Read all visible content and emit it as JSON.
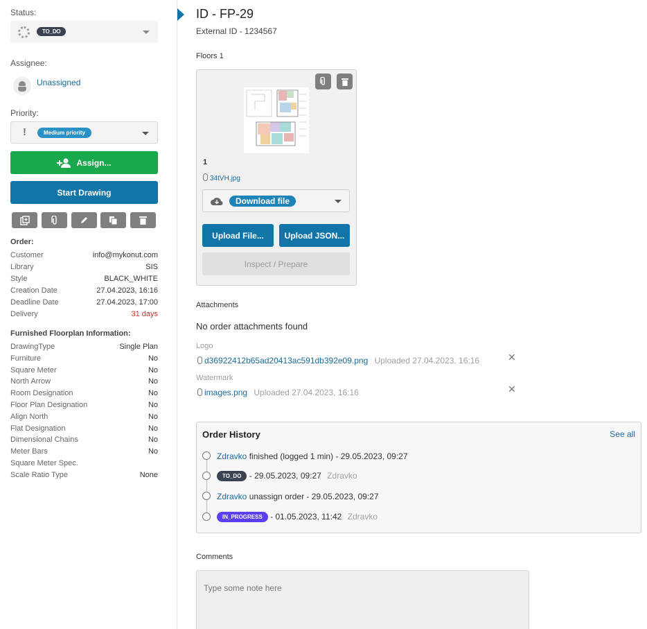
{
  "sidebar": {
    "status_label": "Status:",
    "status_value": "TO_DO",
    "assignee_label": "Assignee:",
    "assignee_value": "Unassigned",
    "priority_label": "Priority:",
    "priority_value": "Medium priority",
    "assign_button": "Assign...",
    "start_drawing_button": "Start Drawing",
    "order_title": "Order:",
    "order": [
      {
        "key": "Customer",
        "value": "info@mykonut.com"
      },
      {
        "key": "Library",
        "value": "SIS"
      },
      {
        "key": "Style",
        "value": "BLACK_WHITE"
      },
      {
        "key": "Creation Date",
        "value": "27.04.2023, 16:16"
      },
      {
        "key": "Deadline Date",
        "value": "27.04.2023, 17:00"
      },
      {
        "key": "Delivery",
        "value": "31 days"
      }
    ],
    "furnished_title": "Furnished Floorplan Information:",
    "furnished": [
      {
        "key": "DrawingType",
        "value": "Single Plan"
      },
      {
        "key": "Furniture",
        "value": "No"
      },
      {
        "key": "Square Meter",
        "value": "No"
      },
      {
        "key": "North Arrow",
        "value": "No"
      },
      {
        "key": "Room Designation",
        "value": "No"
      },
      {
        "key": "Floor Plan Designation",
        "value": "No"
      },
      {
        "key": "Align North",
        "value": "No"
      },
      {
        "key": "Flat Designation",
        "value": "No"
      },
      {
        "key": "Dimensional Chains",
        "value": "No"
      },
      {
        "key": "Meter Bars",
        "value": "No"
      },
      {
        "key": "Square Meter Spec.",
        "value": ""
      },
      {
        "key": "Scale Ratio Type",
        "value": "None"
      }
    ]
  },
  "main": {
    "title": "ID - FP-29",
    "external_id": "External ID - 1234567",
    "floors_label": "Floors 1",
    "floor": {
      "number": "1",
      "file_name": "34tVH.jpg",
      "download_label": "Download file",
      "upload_file": "Upload File...",
      "upload_json": "Upload JSON...",
      "inspect": "Inspect / Prepare"
    },
    "attachments_label": "Attachments",
    "no_attachments": "No order attachments found",
    "logo_label": "Logo",
    "logo_file": "d36922412b65ad20413ac591db392e09.png",
    "logo_uploaded": "Uploaded 27.04.2023, 16:16",
    "watermark_label": "Watermark",
    "watermark_file": "images.png",
    "watermark_uploaded": "Uploaded 27.04.2023, 16:16",
    "history": {
      "title": "Order History",
      "see_all": "See all",
      "entries": [
        {
          "user": "Zdravko",
          "text": " finished (logged 1 min) - 29.05.2023, 09:27"
        },
        {
          "badge": "TO_DO",
          "text": " - 29.05.2023, 09:27",
          "user": "Zdravko"
        },
        {
          "user": "Zdravko",
          "text": " unassign order - 29.05.2023, 09:27"
        },
        {
          "badge": "IN_PROGRESS",
          "text": " - 01.05.2023, 11:42",
          "user": "Zdravko"
        }
      ]
    },
    "comments_label": "Comments",
    "comment_placeholder": "Type some note here"
  },
  "colors": {
    "accent_blue": "#1275a8",
    "green": "#19a84b",
    "delivery_red": "#d2302a",
    "badge_dark": "#3b4252",
    "badge_purple": "#5b3ff0",
    "badge_blue": "#2a91c6"
  },
  "icons": [
    "status-circle-icon",
    "incognito-user-icon",
    "exclamation-icon",
    "add-person-icon",
    "add-copy-icon",
    "paperclip-icon",
    "pencil-icon",
    "duplicate-icon",
    "trash-icon",
    "cloud-download-icon",
    "close-icon"
  ]
}
